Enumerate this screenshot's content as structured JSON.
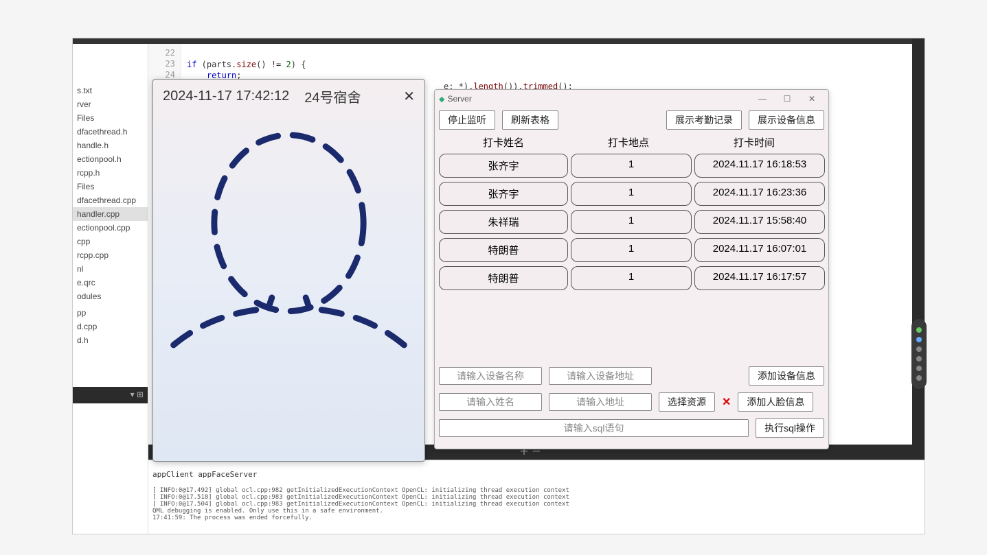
{
  "ide": {
    "files": [
      "s.txt",
      "rver",
      "Files",
      "dfacethread.h",
      "handle.h",
      "ectionpool.h",
      "rcpp.h",
      "Files",
      "dfacethread.cpp",
      "handler.cpp",
      "ectionpool.cpp",
      "cpp",
      "rcpp.cpp",
      "nl",
      "e.qrc",
      "odules"
    ],
    "selected_file_index": 9,
    "secondary_files": [
      "pp",
      "d.cpp",
      "d.h"
    ],
    "gutter_lines": [
      "22",
      "23",
      "24"
    ],
    "code_line_1_a": "if",
    "code_line_1_b": " (parts.",
    "code_line_1_c": "size",
    "code_line_1_d": "() != ",
    "code_line_1_e": "2",
    "code_line_1_f": ") {",
    "code_line_2_a": "    return",
    "code_line_2_b": ";",
    "code_line_3": "}",
    "code_frag_right_a": "e: *).",
    "code_frag_right_b": "length",
    "code_frag_right_c": "()).",
    "code_frag_right_d": "trimmed",
    "code_frag_right_e": "();",
    "console_tabs": "appClient    appFaceServer",
    "console_text": "[ INFO:0@17.492] global ocl.cpp:982 getInitializedExecutionContext OpenCL: initializing thread execution context\n[ INFO:0@17.518] global ocl.cpp:983 getInitializedExecutionContext OpenCL: initializing thread execution context\n[ INFO:0@17.504] global ocl.cpp:983 getInitializedExecutionContext OpenCL: initializing thread execution context\nQML debugging is enabled. Only use this in a safe environment.\n17:41:59: The process was ended forcefully."
  },
  "face_modal": {
    "timestamp": "2024-11-17 17:42:12",
    "location": "24号宿舍"
  },
  "server": {
    "title": "Server",
    "toolbar": {
      "stop_listen": "停止监听",
      "refresh_table": "刷新表格",
      "show_attendance": "展示考勤记录",
      "show_device": "展示设备信息"
    },
    "columns": {
      "name": "打卡姓名",
      "location": "打卡地点",
      "time": "打卡时间"
    },
    "rows": [
      {
        "name": "张齐宇",
        "loc": "1",
        "time": "2024.11.17 16:18:53"
      },
      {
        "name": "张齐宇",
        "loc": "1",
        "time": "2024.11.17 16:23:36"
      },
      {
        "name": "朱祥瑞",
        "loc": "1",
        "time": "2024.11.17 15:58:40"
      },
      {
        "name": "特朗普",
        "loc": "1",
        "time": "2024.11.17 16:07:01"
      },
      {
        "name": "特朗普",
        "loc": "1",
        "time": "2024.11.17 16:17:57"
      }
    ],
    "inputs": {
      "device_name_ph": "请输入设备名称",
      "device_addr_ph": "请输入设备地址",
      "add_device": "添加设备信息",
      "person_name_ph": "请输入姓名",
      "person_addr_ph": "请输入地址",
      "choose_resource": "选择资源",
      "add_face": "添加人脸信息",
      "sql_ph": "请输入sql语句",
      "exec_sql": "执行sql操作"
    }
  }
}
